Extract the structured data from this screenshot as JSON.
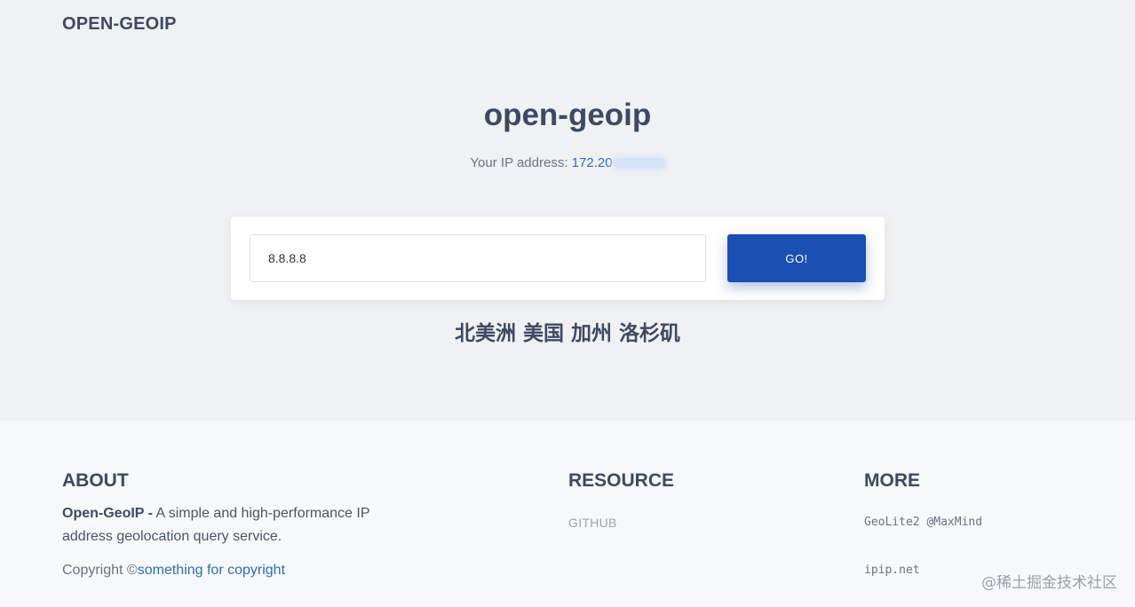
{
  "header": {
    "brand": "OPEN-GEOIP"
  },
  "hero": {
    "title": "open-geoip",
    "ip_label": "Your IP address: ",
    "ip_value": "172.20"
  },
  "search": {
    "input_value": "8.8.8.8",
    "button_label": "GO!"
  },
  "result": {
    "location": "北美洲 美国 加州 洛杉矶"
  },
  "footer": {
    "about": {
      "heading": "ABOUT",
      "name": "Open-GeoIP -",
      "description": " A simple and high-performance IP address geolocation query service.",
      "copyright_prefix": "Copyright ©",
      "copyright_link": "something for copyright"
    },
    "resource": {
      "heading": "RESOURCE",
      "links": [
        "GITHUB"
      ]
    },
    "more": {
      "heading": "MORE",
      "links": [
        "GeoLite2 @MaxMind",
        "ipip.net"
      ]
    }
  },
  "watermark": "@稀土掘金技术社区",
  "colors": {
    "accent": "#1a4fb4",
    "link": "#2f6db5",
    "heading": "#3d4a63",
    "hero_bg": "#f0f1f3",
    "footer_bg": "#f7f8fa"
  }
}
